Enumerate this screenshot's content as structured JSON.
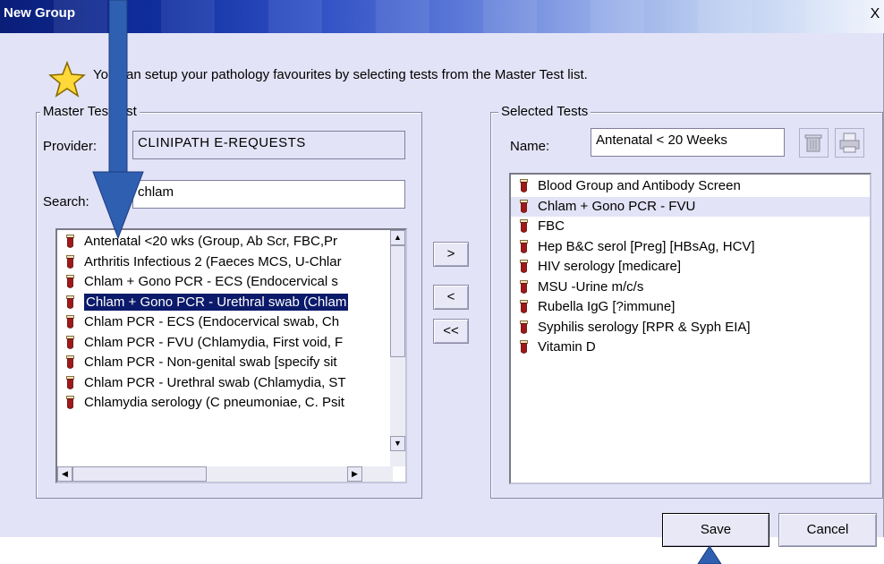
{
  "window": {
    "title": "New Group",
    "close_glyph": "X"
  },
  "intro_text": "You can setup your pathology favourites by selecting tests from the Master Test list.",
  "master": {
    "legend": "Master Test List",
    "provider_label": "Provider:",
    "provider_value": "CLINIPATH E-REQUESTS",
    "search_label": "Search:",
    "search_value": "chlam",
    "items": [
      "Antenatal <20 wks (Group, Ab Scr, FBC,Pr",
      "Arthritis Infectious 2 (Faeces MCS, U-Chlar",
      "Chlam + Gono PCR - ECS (Endocervical s",
      "Chlam + Gono PCR - Urethral swab (Chlam",
      "Chlam PCR - ECS (Endocervical swab, Ch",
      "Chlam PCR - FVU (Chlamydia, First void, F",
      "Chlam PCR - Non-genital swab [specify sit",
      "Chlam PCR - Urethral swab (Chlamydia, ST",
      "Chlamydia serology (C pneumoniae, C. Psit"
    ],
    "selected_index": 3
  },
  "transfer": {
    "add": ">",
    "remove": "<",
    "remove_all": "<<"
  },
  "selected": {
    "legend": "Selected Tests",
    "name_label": "Name:",
    "name_value": "Antenatal < 20 Weeks",
    "items": [
      "Blood Group and Antibody Screen",
      "Chlam + Gono PCR - FVU",
      "FBC",
      "Hep B&C serol [Preg] [HBsAg, HCV]",
      "HIV serology [medicare]",
      "MSU -Urine m/c/s",
      "Rubella IgG [?immune]",
      "Syphilis serology [RPR & Syph EIA]",
      "Vitamin D"
    ],
    "highlighted_index": 1
  },
  "buttons": {
    "save": "Save",
    "cancel": "Cancel"
  },
  "icons": {
    "star": "star-icon",
    "tube": "test-tube-icon",
    "delete": "trash-icon",
    "print": "print-icon"
  },
  "colors": {
    "selection": "#0b1a6a",
    "dialog_bg": "#e3e3f7",
    "annotation_arrow": "#2f5fb0"
  }
}
